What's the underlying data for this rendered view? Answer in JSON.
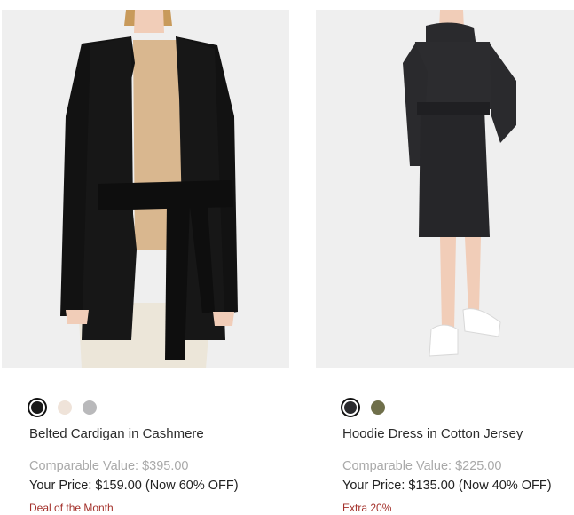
{
  "products": [
    {
      "name": "Belted Cardigan in Cashmere",
      "comparable_value": "Comparable Value: $395.00",
      "your_price": "Your Price: $159.00 (Now 60% OFF)",
      "promo": "Deal of the Month",
      "image_alt": "Belted Cardigan in Cashmere",
      "swatches": [
        {
          "color": "#1a1a1a",
          "selected": true
        },
        {
          "color": "#efe3d9",
          "selected": false
        },
        {
          "color": "#b9b9bb",
          "selected": false
        }
      ]
    },
    {
      "name": "Hoodie Dress in Cotton Jersey",
      "comparable_value": "Comparable Value: $225.00",
      "your_price": "Your Price: $135.00 (Now 40% OFF)",
      "promo": "Extra 20%",
      "image_alt": "Hoodie Dress in Cotton Jersey",
      "swatches": [
        {
          "color": "#2b2b2e",
          "selected": true
        },
        {
          "color": "#6f6f4a",
          "selected": false
        }
      ]
    }
  ]
}
